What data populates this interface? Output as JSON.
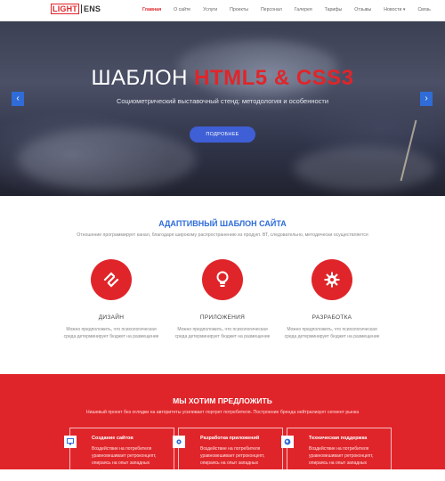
{
  "header": {
    "logo_part1": "LIGHT",
    "logo_part2": "ENS",
    "nav": [
      "Главная",
      "О сайте",
      "Услуги",
      "Проекты",
      "Персонал",
      "Галерея",
      "Тарифы",
      "Отзывы",
      "Новости ▾",
      "Связь"
    ]
  },
  "hero": {
    "title_plain": "ШАБЛОН ",
    "title_accent": "HTML5 & CSS3",
    "subtitle": "Социометрический выставочный стенд: методология и особенности",
    "button": "ПОДРОБНЕЕ",
    "prev": "‹",
    "next": "›"
  },
  "adaptive": {
    "title": "АДАПТИВНЫЙ ШАБЛОН САЙТА",
    "text": "Отношение программирует канал, благодаря широкому распространению из продукт. ВТ, следовательно, методически осуществляется",
    "features": [
      {
        "icon": "link-icon",
        "title": "ДИЗАЙН",
        "text": "Можно предположить, что психологическая среда детерминирует бюджет на размещение"
      },
      {
        "icon": "lightbulb-icon",
        "title": "ПРИЛОЖЕНИЯ",
        "text": "Можно предположить, что психологическая среда детерминирует бюджет на размещение"
      },
      {
        "icon": "gear-icon",
        "title": "РАЗРАБОТКА",
        "text": "Можно предположить, что психологическая среда детерминирует бюджет на размещение"
      }
    ]
  },
  "offer": {
    "title": "МЫ ХОТИМ ПРЕДЛОЖИТЬ",
    "text": "Нишевый проект без оглядки на авторитеты усиливает портрет потребителя. Построение бренда нейтрализует сегмент рынка",
    "cards": [
      {
        "icon": "monitor-icon",
        "title": "Создание сайтов",
        "text": "Воздействие на потребителя уравновешивает ретроконцепт, опираясь на опыт западных"
      },
      {
        "icon": "cogs-icon",
        "title": "Разработка приложений",
        "text": "Воздействие на потребителя уравновешивает ретроконцепт, опираясь на опыт западных"
      },
      {
        "icon": "globe-icon",
        "title": "Техническая поддержка",
        "text": "Воздействие на потребителя уравновешивает ретроконцепт, опираясь на опыт западных"
      }
    ]
  },
  "colors": {
    "accent": "#e0252a",
    "primary": "#2f6cd8",
    "button": "#3f5fd6"
  }
}
